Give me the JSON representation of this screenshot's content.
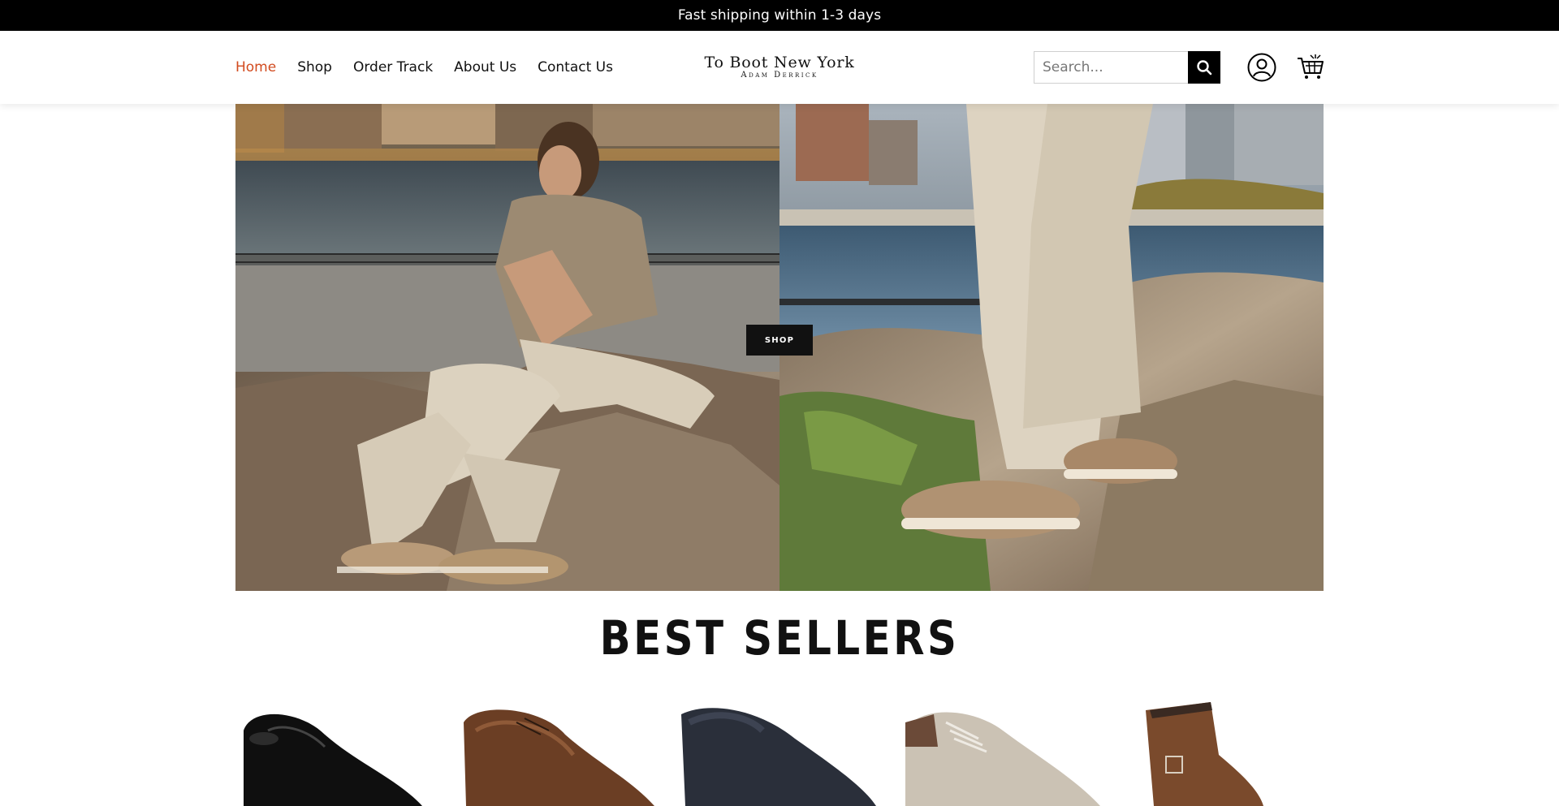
{
  "announcement": {
    "text": "Fast shipping within 1-3 days"
  },
  "nav": {
    "items": [
      {
        "label": "Home",
        "active": true
      },
      {
        "label": "Shop"
      },
      {
        "label": "Order Track"
      },
      {
        "label": "About Us"
      },
      {
        "label": "Contact Us"
      }
    ]
  },
  "brand": {
    "line1": "To Boot New York",
    "line2": "Adam Derrick"
  },
  "search": {
    "placeholder": "Search...",
    "value": ""
  },
  "hero": {
    "cta_label": "SHOP"
  },
  "best_sellers": {
    "title": "BEST SELLERS",
    "products": [
      {
        "image": "black-leather-oxford"
      },
      {
        "image": "brown-leather-derby"
      },
      {
        "image": "navy-suede-loafer"
      },
      {
        "image": "beige-suede-sneaker"
      },
      {
        "image": "brown-suede-buckle-boot"
      }
    ]
  },
  "colors": {
    "accent": "#d24b1f",
    "announcement_bg": "#000000"
  }
}
